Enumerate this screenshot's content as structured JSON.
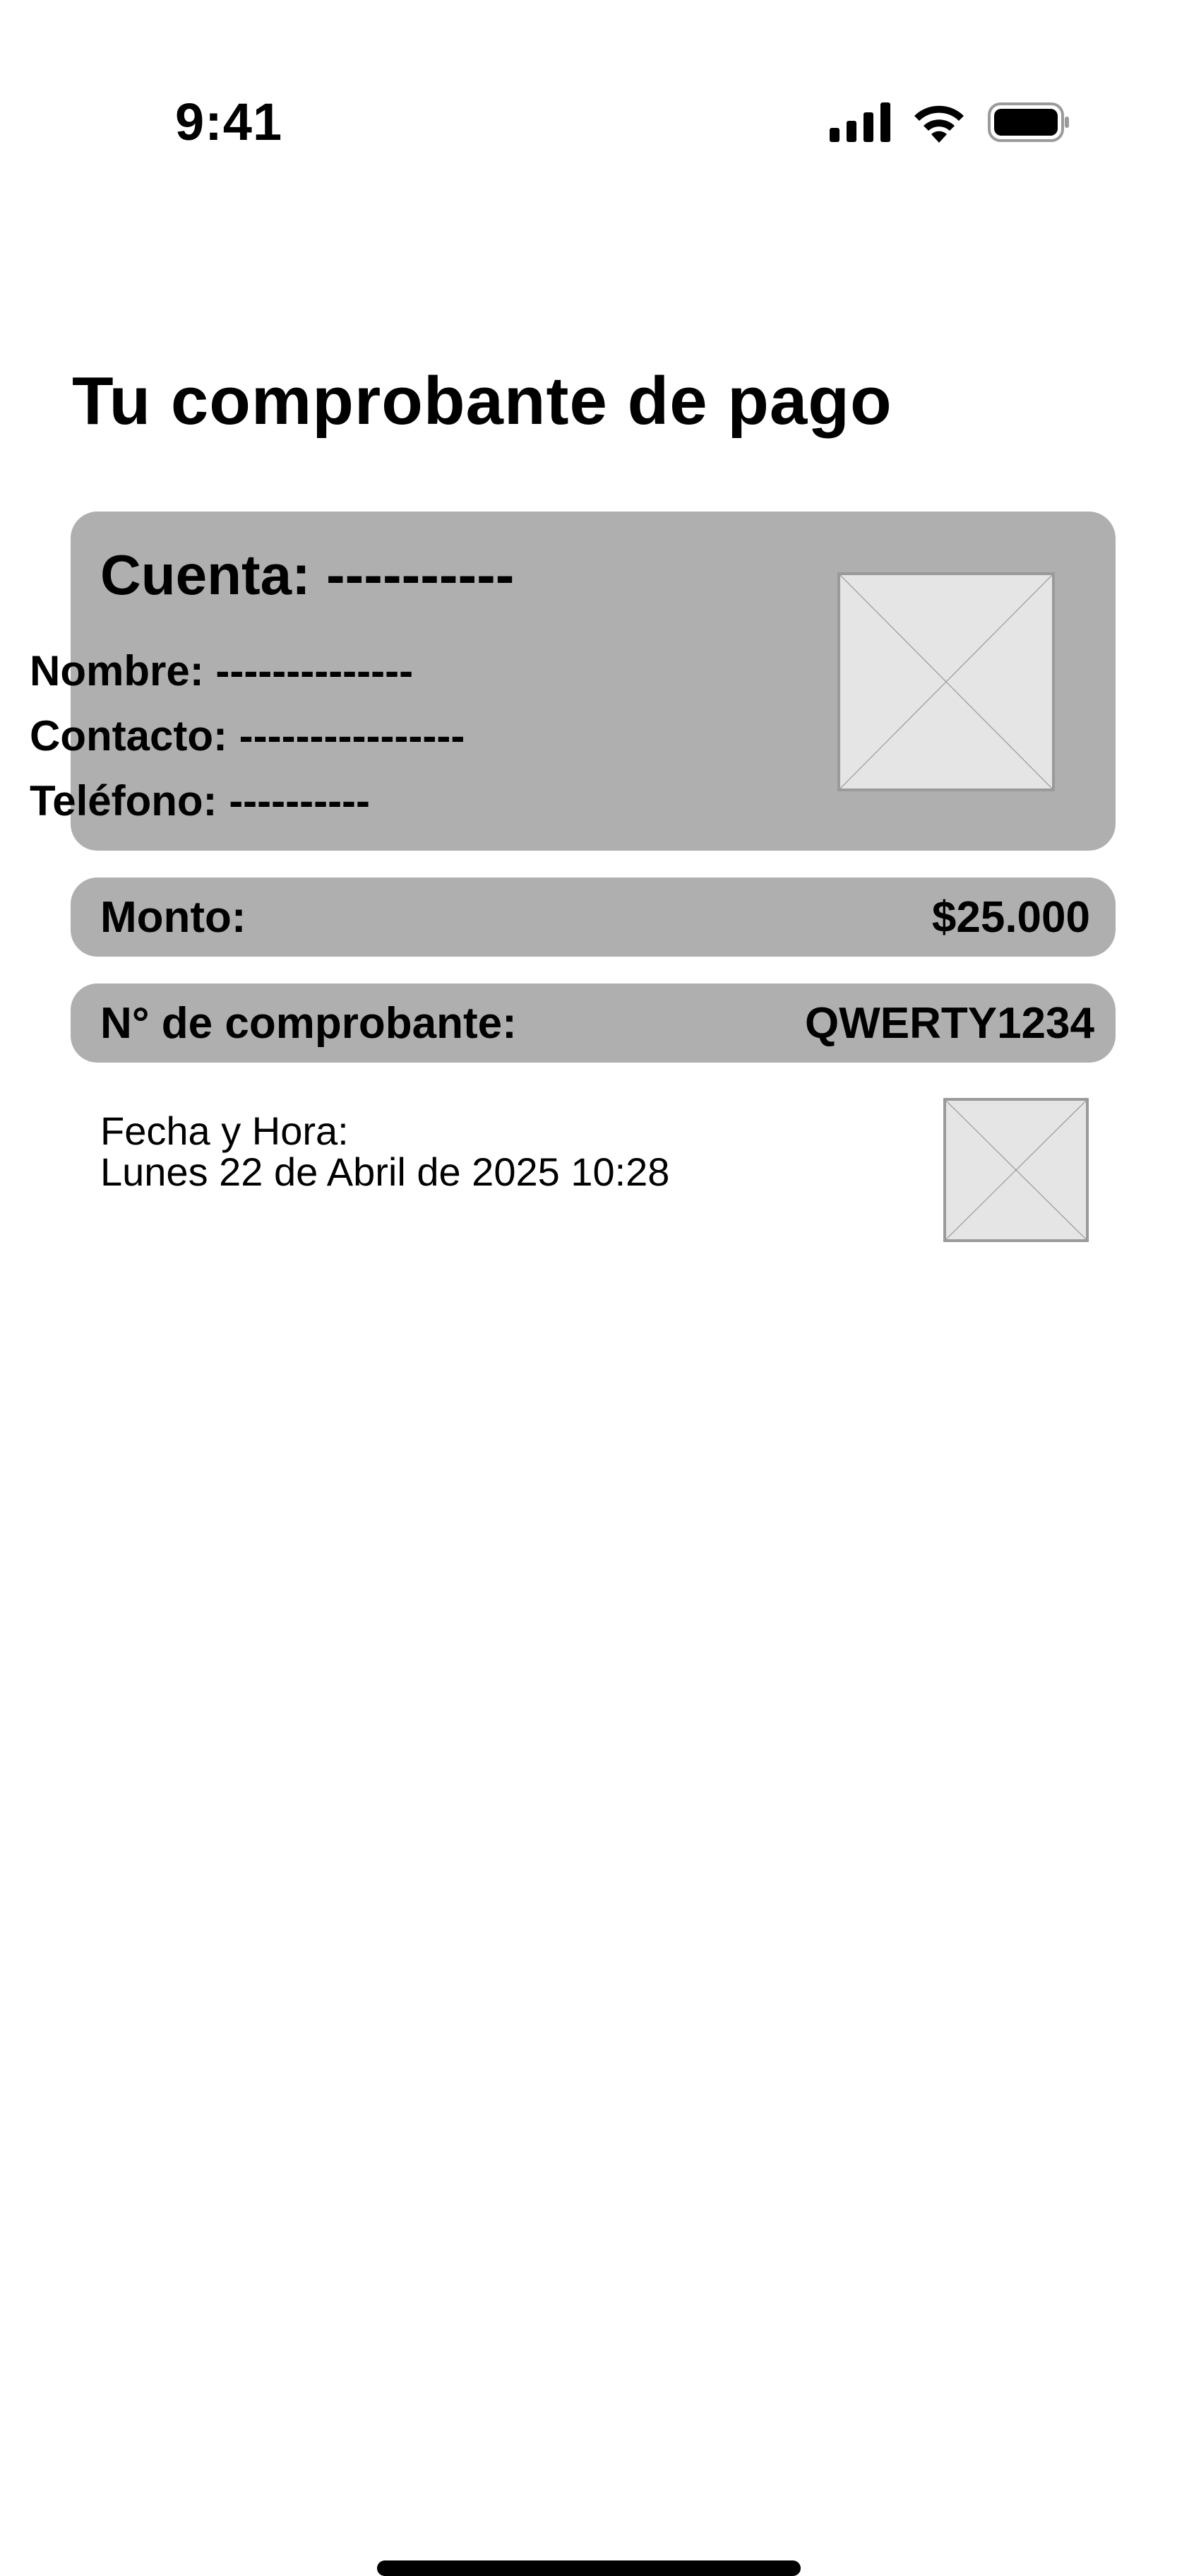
{
  "status_bar": {
    "time": "9:41",
    "icons": [
      "cellular-signal-icon",
      "wifi-icon",
      "battery-icon"
    ]
  },
  "page": {
    "title": "Tu comprobante de pago"
  },
  "account_card": {
    "heading_label": "Cuenta:",
    "heading_value": "----------",
    "name_label": "Nombre:",
    "name_value": "--------------",
    "contact_label": "Contacto:",
    "contact_value": "----------------",
    "phone_label": "Teléfono:",
    "phone_value": "----------"
  },
  "amount": {
    "label": "Monto:",
    "value": "$25.000"
  },
  "voucher": {
    "label": "N° de comprobante:",
    "value": "QWERTY1234"
  },
  "date": {
    "label": "Fecha y Hora:",
    "value": "Lunes 22 de Abril de 2025 10:28"
  },
  "colors": {
    "card_background": "#afafaf",
    "placeholder_fill": "#e5e5e5",
    "placeholder_stroke": "#9a9a9a",
    "text": "#000000",
    "background": "#ffffff"
  }
}
